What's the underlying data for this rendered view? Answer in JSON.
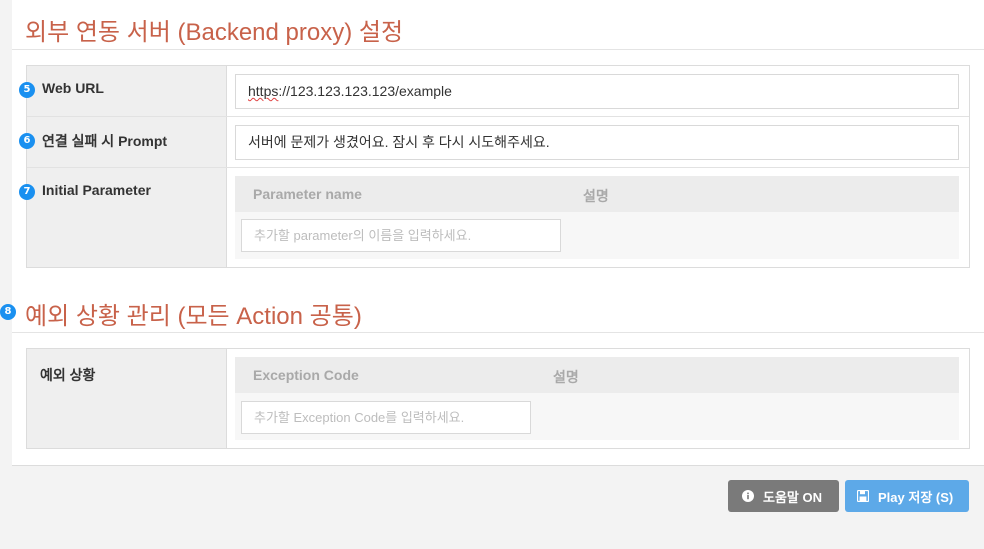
{
  "backend_section": {
    "title": "외부 연동 서버 (Backend proxy) 설정",
    "rows": {
      "web_url": {
        "badge": "5",
        "label": "Web URL",
        "value_prefix": "https",
        "value_rest": "://123.123.123.123/example"
      },
      "fail_prompt": {
        "badge": "6",
        "label": "연결 실패 시 Prompt",
        "value": "서버에 문제가 생겼어요. 잠시 후 다시 시도해주세요."
      },
      "initial_param": {
        "badge": "7",
        "label": "Initial Parameter",
        "col_name": "Parameter name",
        "col_desc": "설명",
        "input_placeholder": "추가할 parameter의 이름을 입력하세요."
      }
    }
  },
  "exception_section": {
    "badge": "8",
    "title": "예외 상황 관리 (모든 Action 공통)",
    "row_label": "예외 상황",
    "col_code": "Exception Code",
    "col_desc": "설명",
    "input_placeholder": "추가할 Exception Code를 입력하세요."
  },
  "footer": {
    "help_button": "도움말 ON",
    "help_icon": "info-circle-icon",
    "play_button": "Play 저장 (S)",
    "play_icon": "floppy-disk-icon"
  },
  "colors": {
    "title": "#c8624a",
    "badge": "#1a90f0",
    "help_button": "#7a7a7a",
    "play_button": "#5da9e8"
  }
}
